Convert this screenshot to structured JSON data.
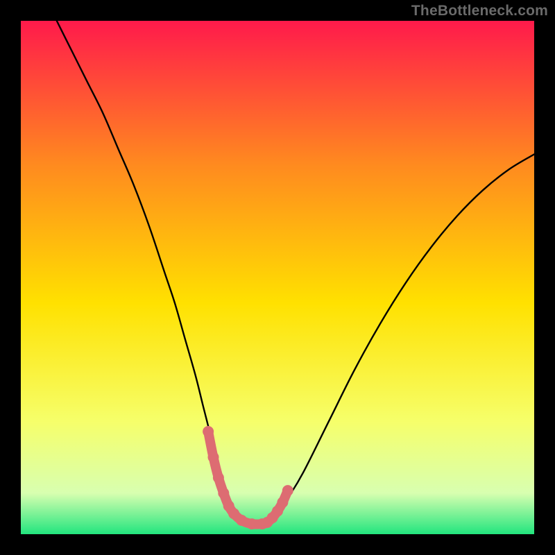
{
  "watermark": {
    "text": "TheBottleneck.com"
  },
  "colors": {
    "frame": "#000000",
    "watermark": "#6a6a6a",
    "curve": "#000000",
    "pinkStroke": "#dd6c72",
    "gradient": {
      "top": "#ff1a4b",
      "upperMid": "#ff8a1f",
      "mid": "#ffe100",
      "lowerMid": "#f6ff6a",
      "nearBottom": "#d8ffb0",
      "bottom": "#22e57e"
    }
  },
  "chart_data": {
    "type": "line",
    "title": "",
    "xlabel": "",
    "ylabel": "",
    "xlim": [
      0,
      100
    ],
    "ylim": [
      0,
      100
    ],
    "grid": false,
    "legend": false,
    "annotations": [
      "TheBottleneck.com"
    ],
    "series": [
      {
        "name": "bottleneck-curve",
        "x": [
          7,
          10,
          13,
          16,
          19,
          22,
          25,
          28,
          30,
          32,
          34,
          35.5,
          37,
          38,
          39,
          40,
          41,
          43,
          45,
          47,
          48.5,
          50,
          52,
          55,
          60,
          65,
          70,
          75,
          80,
          85,
          90,
          95,
          100
        ],
        "y": [
          100,
          94,
          88,
          82,
          75,
          68,
          60,
          51,
          45,
          38,
          31,
          25,
          19,
          14,
          10,
          7,
          5,
          3,
          2,
          2,
          2.5,
          4,
          7,
          12,
          22,
          32,
          41,
          49,
          56,
          62,
          67,
          71,
          74
        ]
      },
      {
        "name": "pink-highlight",
        "x": [
          36.5,
          37.5,
          38.5,
          39.5,
          40.5,
          41.5,
          43,
          45,
          47,
          48,
          49,
          50,
          51,
          52
        ],
        "y": [
          20,
          15,
          11,
          8,
          5.5,
          4,
          2.7,
          2,
          2,
          2.3,
          3.2,
          4.5,
          6.2,
          8.5
        ]
      }
    ]
  }
}
